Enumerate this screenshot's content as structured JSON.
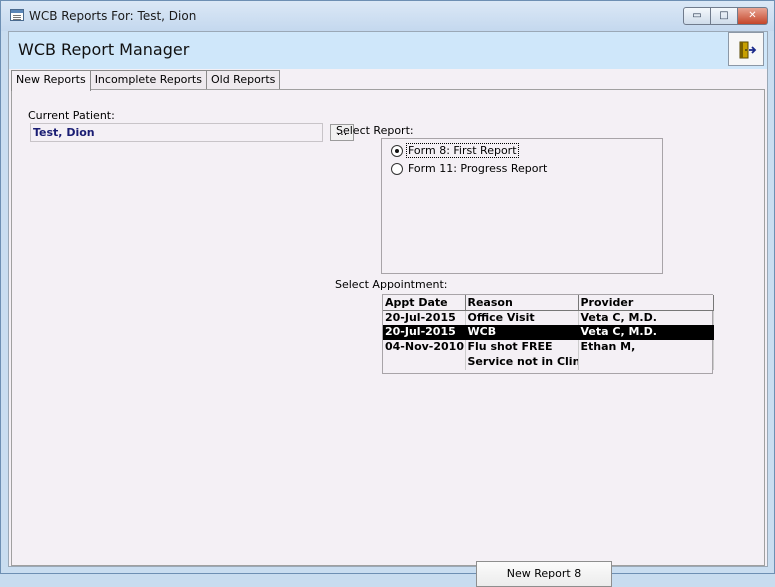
{
  "window": {
    "title": "WCB Reports For: Test, Dion",
    "buttons": {
      "minimize": "▭",
      "maximize": "□",
      "close": "✕"
    }
  },
  "header": {
    "title": "WCB Report Manager",
    "exit_icon": "exit-door-icon"
  },
  "tabs": [
    {
      "label": "New Reports",
      "active": true
    },
    {
      "label": "Incomplete Reports",
      "active": false
    },
    {
      "label": "Old Reports",
      "active": false
    }
  ],
  "patient": {
    "label": "Current Patient:",
    "value": "Test, Dion",
    "browse_label": "..."
  },
  "report_select": {
    "label": "Select Report:",
    "options": [
      {
        "label": "Form 8: First Report",
        "checked": true
      },
      {
        "label": "Form 11: Progress Report",
        "checked": false
      }
    ]
  },
  "appointments": {
    "label": "Select Appointment:",
    "columns": [
      "Appt Date",
      "Reason",
      "Provider"
    ],
    "rows": [
      {
        "date": "20-Jul-2015",
        "reason": "Office Visit",
        "provider": "Veta C, M.D.",
        "selected": false
      },
      {
        "date": "20-Jul-2015",
        "reason": "WCB",
        "provider": "Veta C, M.D.",
        "selected": true
      },
      {
        "date": "04-Nov-2010",
        "reason": "Flu shot FREE",
        "provider": "Ethan M,",
        "selected": false
      },
      {
        "date": "",
        "reason": "Service not in Clinic",
        "provider": "",
        "selected": false
      }
    ]
  },
  "actions": {
    "new_report_label": "New Report 8"
  }
}
